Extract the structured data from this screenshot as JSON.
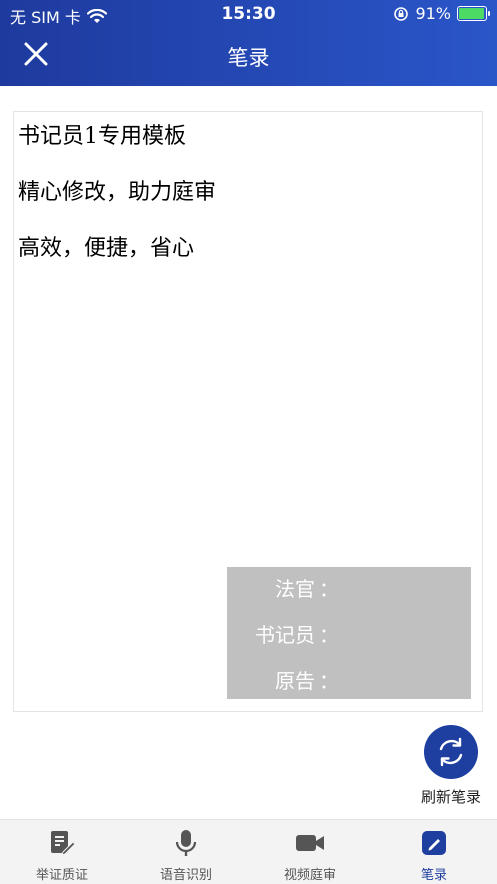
{
  "status_bar": {
    "carrier": "无 SIM 卡",
    "time": "15:30",
    "battery": "91%"
  },
  "header": {
    "title": "笔录"
  },
  "document": {
    "lines": [
      "书记员1专用模板",
      "精心修改，助力庭审",
      "高效，便捷，省心"
    ],
    "signatures": [
      {
        "label": "法官",
        "colon": "："
      },
      {
        "label": "书记员",
        "colon": "："
      },
      {
        "label": "原告",
        "colon": "："
      }
    ]
  },
  "refresh": {
    "label": "刷新笔录"
  },
  "tabs": [
    {
      "label": "举证质证",
      "icon": "evidence-icon"
    },
    {
      "label": "语音识别",
      "icon": "microphone-icon"
    },
    {
      "label": "视频庭审",
      "icon": "video-camera-icon"
    },
    {
      "label": "笔录",
      "icon": "edit-note-icon",
      "active": true
    }
  ],
  "colors": {
    "header_start": "#1e3a9e",
    "header_end": "#2a56c9",
    "accent": "#1e3fa0",
    "signature_box": "#c0c0c0"
  }
}
